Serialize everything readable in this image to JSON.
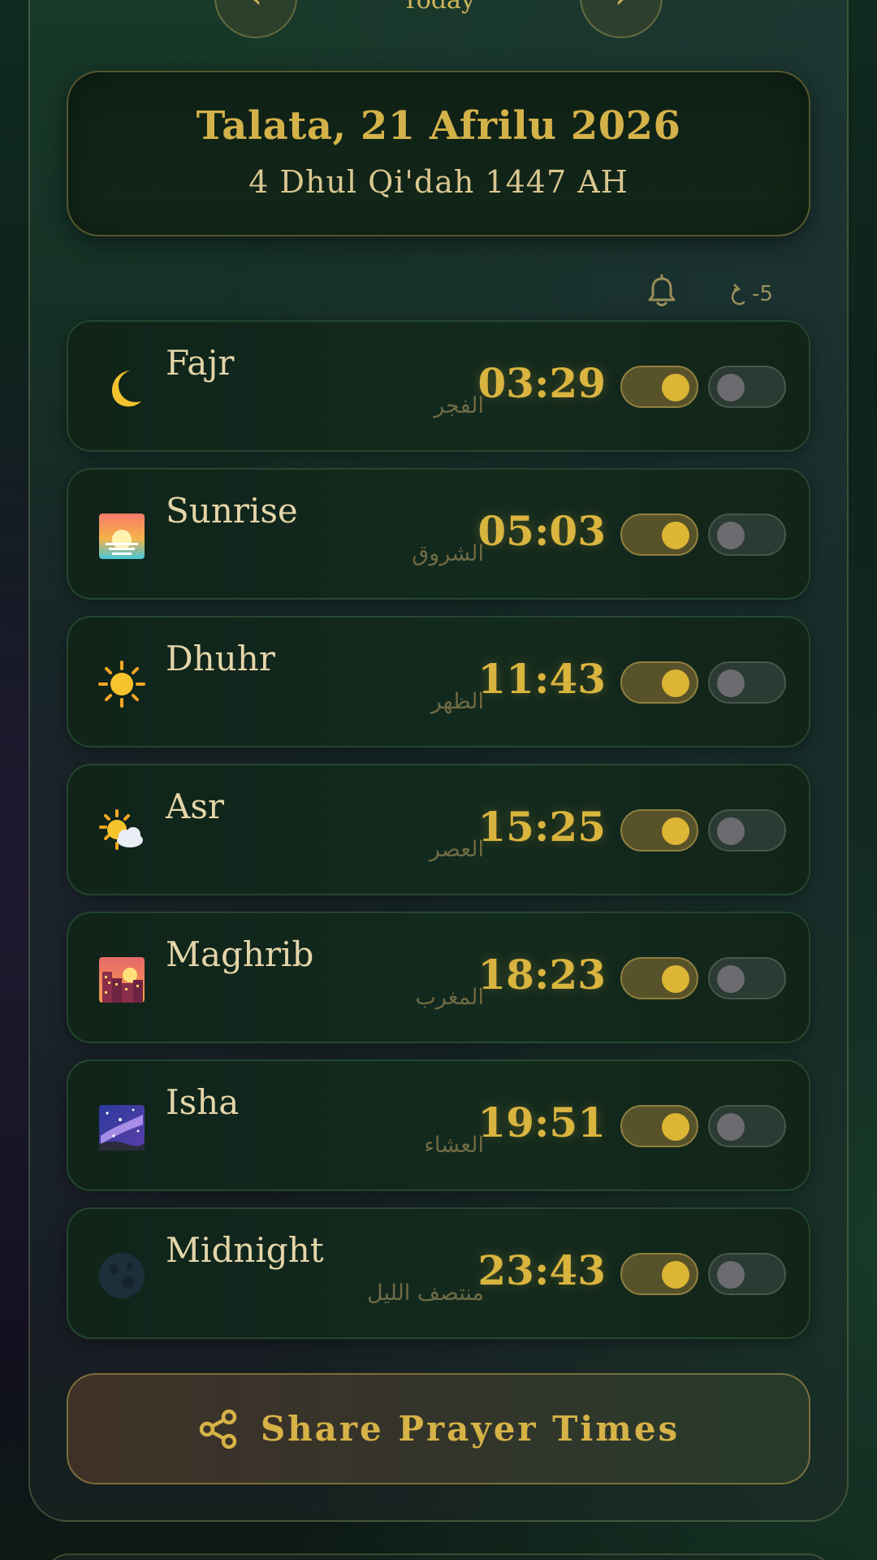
{
  "nav": {
    "prev_icon": "chevron-left-icon",
    "next_icon": "chevron-right-icon",
    "label": "Today"
  },
  "date": {
    "gregorian": "Talata, 21 Afrilu 2026",
    "hijri": "4 Dhul Qi'dah 1447 AH"
  },
  "header": {
    "bell_icon": "bell-icon",
    "offset_icon": "adjust-icon",
    "offset_value": "-5"
  },
  "prayers": [
    {
      "name": "Fajr",
      "arabic": "الفجر",
      "time": "03:29",
      "icon": "crescent-moon-icon",
      "notify": true,
      "adhan": false
    },
    {
      "name": "Sunrise",
      "arabic": "الشروق",
      "time": "05:03",
      "icon": "sunrise-icon",
      "notify": true,
      "adhan": false
    },
    {
      "name": "Dhuhr",
      "arabic": "الظهر",
      "time": "11:43",
      "icon": "sun-icon",
      "notify": true,
      "adhan": false
    },
    {
      "name": "Asr",
      "arabic": "العصر",
      "time": "15:25",
      "icon": "sun-cloud-icon",
      "notify": true,
      "adhan": false
    },
    {
      "name": "Maghrib",
      "arabic": "المغرب",
      "time": "18:23",
      "icon": "sunset-city-icon",
      "notify": true,
      "adhan": false
    },
    {
      "name": "Isha",
      "arabic": "العشاء",
      "time": "19:51",
      "icon": "milky-way-icon",
      "notify": true,
      "adhan": false
    },
    {
      "name": "Midnight",
      "arabic": "منتصف الليل",
      "time": "23:43",
      "icon": "new-moon-icon",
      "notify": true,
      "adhan": false
    }
  ],
  "share": {
    "label": "Share Prayer Times",
    "icon": "share-icon"
  },
  "colors": {
    "gold": "#d9b43f",
    "text": "#e4d5a8",
    "bg": "#0f2a1e"
  }
}
